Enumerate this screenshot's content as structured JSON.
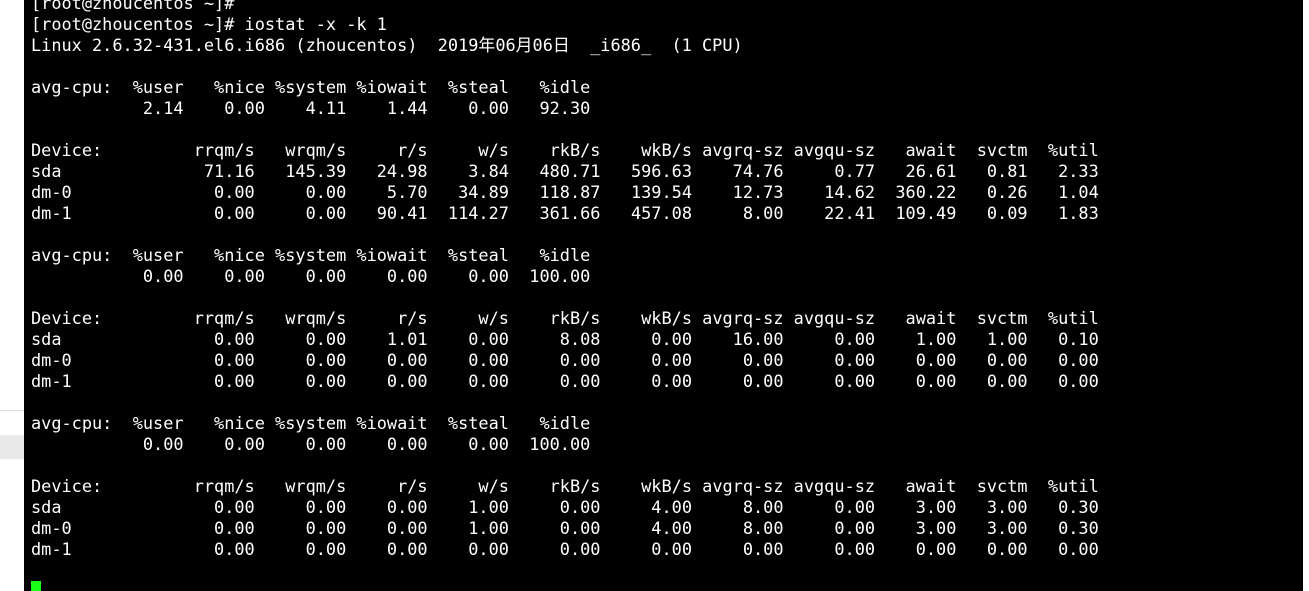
{
  "terminal": {
    "prompt_prev": "[root@zhoucentos ~]#",
    "prompt_cmd": "[root@zhoucentos ~]# iostat -x -k 1",
    "system_line": "Linux 2.6.32-431.el6.i686 (zhoucentos)  2019年06月06日  _i686_  (1 CPU)",
    "cpu_header": "avg-cpu:  %user   %nice %system %iowait  %steal   %idle",
    "device_header": "Device:         rrqm/s   wrqm/s     r/s     w/s    rkB/s    wkB/s avgrq-sz avgqu-sz   await  svctm  %util",
    "blocks": [
      {
        "cpu_values": "           2.14    0.00    4.11    1.44    0.00   92.30",
        "devices": [
          "sda              71.16   145.39   24.98    3.84   480.71   596.63    74.76     0.77   26.61   0.81   2.33",
          "dm-0              0.00     0.00    5.70   34.89   118.87   139.54    12.73    14.62  360.22   0.26   1.04",
          "dm-1              0.00     0.00   90.41  114.27   361.66   457.08     8.00    22.41  109.49   0.09   1.83"
        ]
      },
      {
        "cpu_values": "           0.00    0.00    0.00    0.00    0.00  100.00",
        "devices": [
          "sda               0.00     0.00    1.01    0.00     8.08     0.00    16.00     0.00    1.00   1.00   0.10",
          "dm-0              0.00     0.00    0.00    0.00     0.00     0.00     0.00     0.00    0.00   0.00   0.00",
          "dm-1              0.00     0.00    0.00    0.00     0.00     0.00     0.00     0.00    0.00   0.00   0.00"
        ]
      },
      {
        "cpu_values": "           0.00    0.00    0.00    0.00    0.00  100.00",
        "devices": [
          "sda               0.00     0.00    0.00    1.00     0.00     4.00     8.00     0.00    3.00   3.00   0.30",
          "dm-0              0.00     0.00    0.00    1.00     0.00     4.00     8.00     0.00    3.00   3.00   0.30",
          "dm-1              0.00     0.00    0.00    0.00     0.00     0.00     0.00     0.00    0.00   0.00   0.00"
        ]
      }
    ],
    "cursor_color": "#1aff1a"
  }
}
